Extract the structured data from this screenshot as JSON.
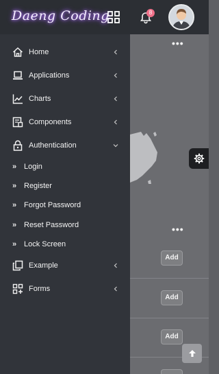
{
  "brand": {
    "name": "Daeng Coding"
  },
  "header": {
    "notification_count": "8"
  },
  "sidebar": {
    "items": [
      {
        "label": "Home",
        "icon": "home-icon",
        "expanded": false
      },
      {
        "label": "Applications",
        "icon": "laptop-icon",
        "expanded": false
      },
      {
        "label": "Charts",
        "icon": "chart-line-icon",
        "expanded": false
      },
      {
        "label": "Components",
        "icon": "components-icon",
        "expanded": false
      },
      {
        "label": "Authentication",
        "icon": "lock-icon",
        "expanded": true
      }
    ],
    "auth_subitems": [
      "Login",
      "Register",
      "Forgot Password",
      "Reset Password",
      "Lock Screen"
    ],
    "items_after": [
      {
        "label": "Example",
        "icon": "copy-icon",
        "expanded": false
      },
      {
        "label": "Forms",
        "icon": "grid-plus-icon",
        "expanded": false
      }
    ]
  },
  "content": {
    "more_label": "•••",
    "add_label": "Add"
  },
  "colors": {
    "sidebar_bg": "#31343a",
    "overlay_bg": "#6b6c70",
    "badge": "#f0718a",
    "brand_glow": "#9a58ff"
  }
}
